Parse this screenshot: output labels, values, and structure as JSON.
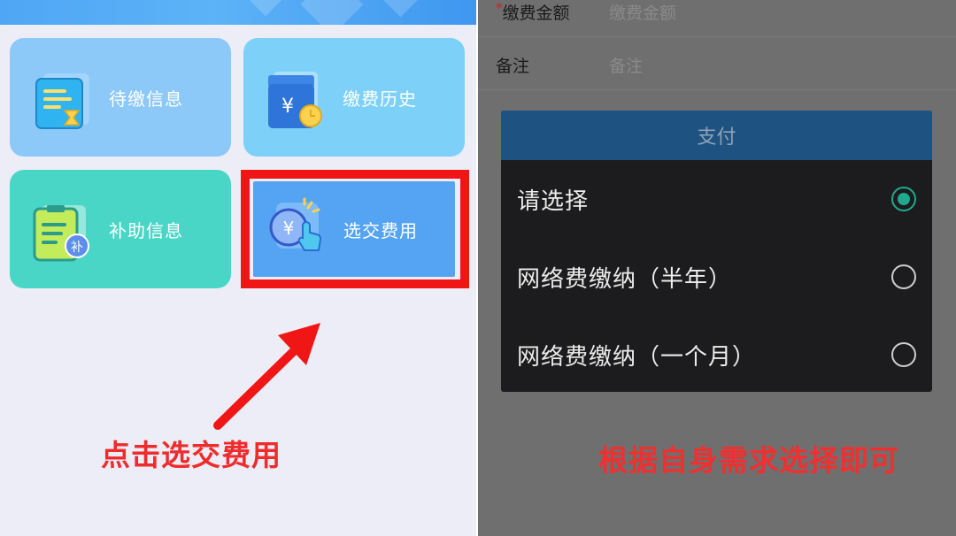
{
  "colors": {
    "highlight": "#f01616",
    "caption": "#ee2c2c",
    "radio_selected": "#1faa8e",
    "dialog_header": "#1d5281"
  },
  "left_panel": {
    "tiles": [
      {
        "label": "待缴信息",
        "icon": "pending-invoice-icon"
      },
      {
        "label": "缴费历史",
        "icon": "payment-history-icon"
      },
      {
        "label": "补助信息",
        "icon": "subsidy-doc-icon"
      },
      {
        "label": "选交费用",
        "icon": "select-fee-icon"
      }
    ],
    "caption": "点击选交费用"
  },
  "right_panel": {
    "form": {
      "amount": {
        "label": "缴费金额",
        "placeholder": "缴费金额",
        "required_mark": "*"
      },
      "note": {
        "label": "备注",
        "placeholder": "备注"
      }
    },
    "dialog": {
      "title": "支付",
      "options": [
        {
          "label": "请选择",
          "selected": true
        },
        {
          "label": "网络费缴纳（半年）",
          "selected": false
        },
        {
          "label": "网络费缴纳（一个月）",
          "selected": false
        }
      ]
    },
    "caption": "根据自身需求选择即可"
  }
}
